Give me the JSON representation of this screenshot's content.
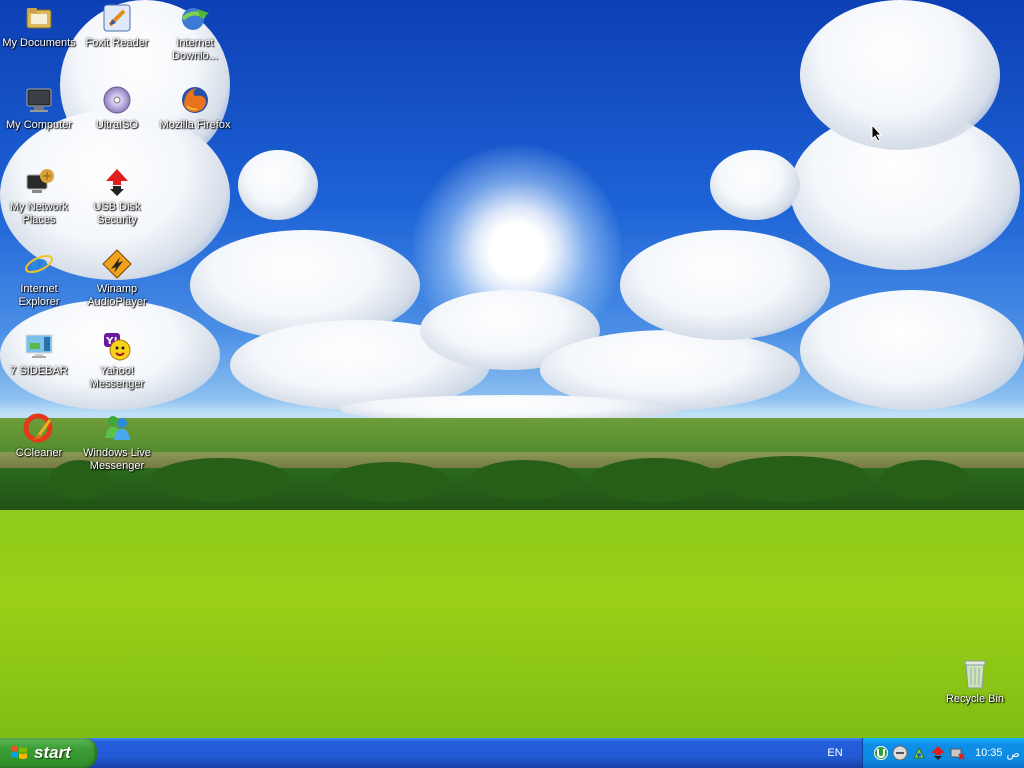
{
  "desktop": {
    "icons": [
      {
        "label": "My Documents",
        "icon": "folder-documents-icon"
      },
      {
        "label": "Foxit Reader",
        "icon": "foxit-reader-icon"
      },
      {
        "label": "Internet\nDownlo...",
        "icon": "internet-download-manager-icon"
      },
      {
        "label": "My Computer",
        "icon": "computer-monitor-icon"
      },
      {
        "label": "UltraISO",
        "icon": "disc-icon"
      },
      {
        "label": "Mozilla Firefox",
        "icon": "firefox-icon"
      },
      {
        "label": "My Network\nPlaces",
        "icon": "network-places-icon"
      },
      {
        "label": "USB Disk\nSecurity",
        "icon": "usb-security-icon"
      },
      {
        "label": "Internet\nExplorer",
        "icon": "internet-explorer-icon"
      },
      {
        "label": "Winamp\nAudioPlayer",
        "icon": "winamp-icon"
      },
      {
        "label": "7 SIDEBAR",
        "icon": "sidebar-icon"
      },
      {
        "label": "Yahoo!\nMessenger",
        "icon": "yahoo-messenger-icon"
      },
      {
        "label": "CCleaner",
        "icon": "ccleaner-icon"
      },
      {
        "label": "Windows Live\nMessenger",
        "icon": "windows-live-messenger-icon"
      },
      {
        "label": "Recycle Bin",
        "icon": "recycle-bin-icon"
      }
    ]
  },
  "taskbar": {
    "start_label": "start",
    "language": "EN",
    "clock": "10:35",
    "clock_suffix": "ص",
    "tray_icons": [
      "utorrent-icon",
      "yahoo-status-icon",
      "network-icon",
      "usb-security-icon",
      "safely-remove-icon"
    ]
  },
  "colors": {
    "taskbar": "#245edb",
    "start_button": "#3c9e35",
    "tray": "#0f8fe8"
  }
}
